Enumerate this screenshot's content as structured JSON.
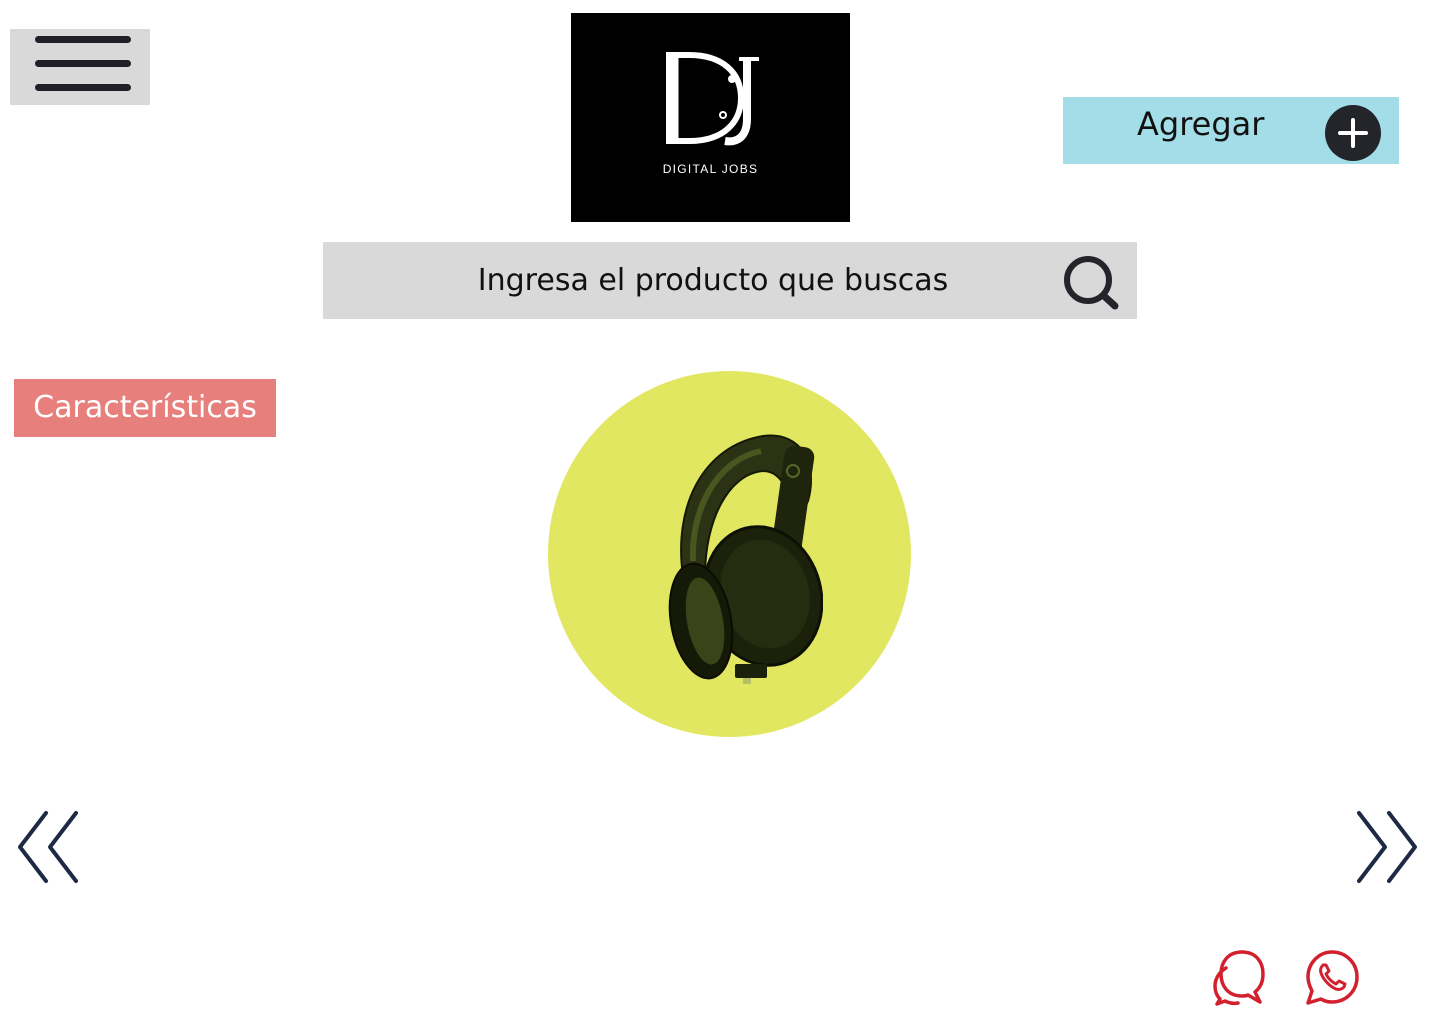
{
  "header": {
    "menu_icon": "hamburger-menu-icon",
    "logo": {
      "monogram": "DJ",
      "text": "DIGITAL JOBS"
    },
    "add_button": {
      "label": "Agregar",
      "icon": "plus-circle-icon"
    }
  },
  "search": {
    "placeholder": "Ingresa el producto que buscas",
    "value": "",
    "icon": "search-icon"
  },
  "features_button": {
    "label": "Características"
  },
  "product": {
    "image": "headphones-image"
  },
  "navigation": {
    "prev_icon": "double-chevron-left-icon",
    "next_icon": "double-chevron-right-icon"
  },
  "contact": {
    "chat_icon": "chat-bubbles-icon",
    "whatsapp_icon": "whatsapp-icon"
  },
  "colors": {
    "menu_bg": "#d9d9d9",
    "add_button_bg": "#a3dde8",
    "features_bg": "#e77f7d",
    "product_circle": "#e2e761",
    "icon_dark": "#1e2a45",
    "contact_red": "#d3202f"
  }
}
